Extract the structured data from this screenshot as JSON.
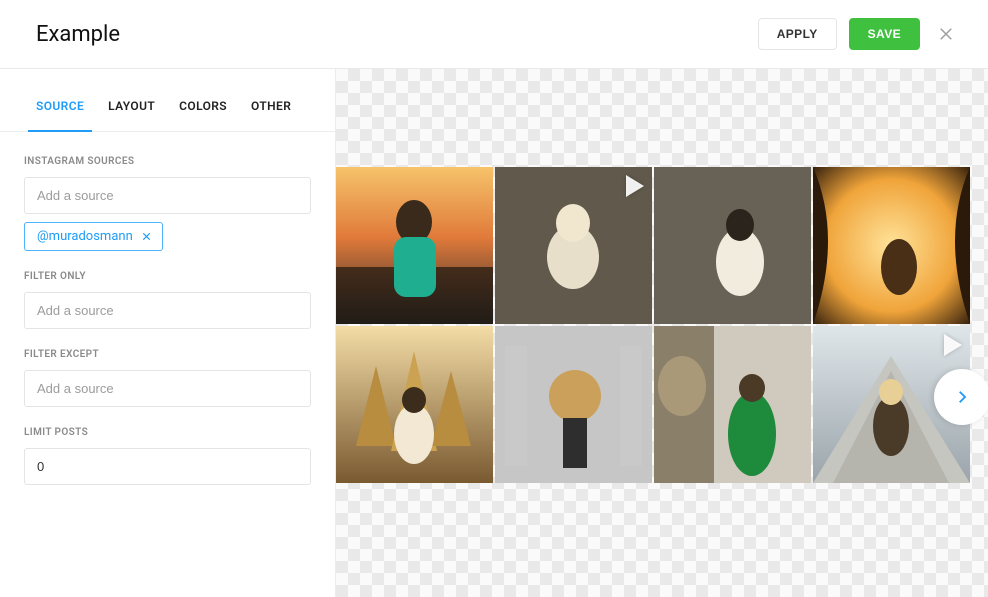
{
  "header": {
    "title": "Example",
    "apply_label": "APPLY",
    "save_label": "SAVE"
  },
  "tabs": [
    {
      "label": "SOURCE",
      "active": true
    },
    {
      "label": "LAYOUT",
      "active": false
    },
    {
      "label": "COLORS",
      "active": false
    },
    {
      "label": "OTHER",
      "active": false
    }
  ],
  "sections": {
    "instagram_sources": {
      "label": "INSTAGRAM SOURCES",
      "placeholder": "Add a source",
      "chips": [
        "@muradosmann"
      ]
    },
    "filter_only": {
      "label": "FILTER ONLY",
      "placeholder": "Add a source"
    },
    "filter_except": {
      "label": "FILTER EXCEPT",
      "placeholder": "Add a source"
    },
    "limit_posts": {
      "label": "LIMIT POSTS",
      "value": "0"
    }
  },
  "preview": {
    "tiles": [
      {
        "is_video": false
      },
      {
        "is_video": true
      },
      {
        "is_video": false
      },
      {
        "is_video": false
      },
      {
        "is_video": false
      },
      {
        "is_video": false
      },
      {
        "is_video": false
      },
      {
        "is_video": true
      }
    ]
  }
}
